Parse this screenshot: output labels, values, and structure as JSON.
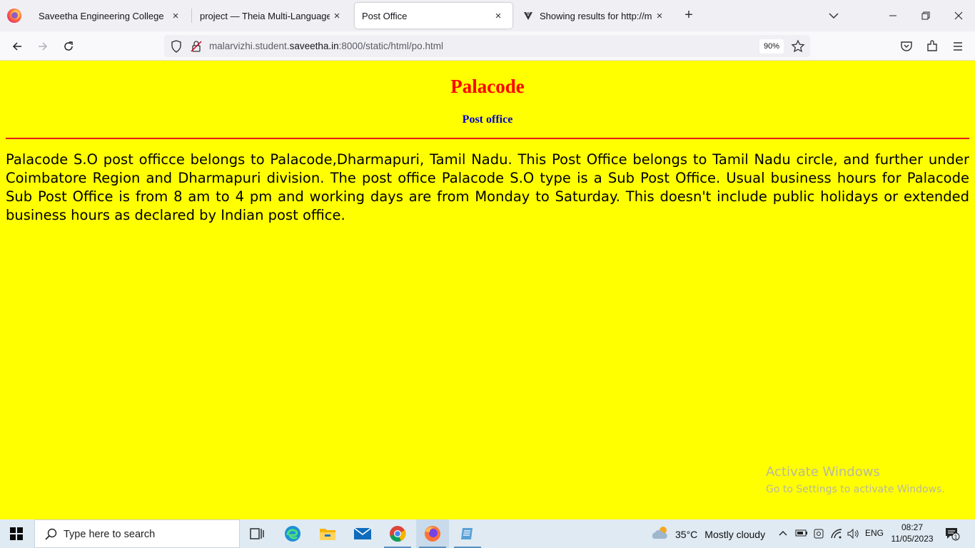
{
  "browser": {
    "tabs": [
      {
        "title": "Saveetha Engineering College",
        "close": "×",
        "active": false
      },
      {
        "title": "project — Theia Multi-Language Ex",
        "close": "×",
        "active": false
      },
      {
        "title": "Post Office",
        "close": "×",
        "active": true
      },
      {
        "title": "Showing results for http://malar",
        "close": "×",
        "active": false
      }
    ],
    "new_tab": "+",
    "url": {
      "prefix": "malarvizhi.student.",
      "host": "saveetha.in",
      "suffix": ":8000/static/html/po.html"
    },
    "zoom": "90%",
    "window_controls": {
      "minimize": "—",
      "restore": "❐",
      "close": "✕"
    }
  },
  "page": {
    "heading": "Palacode",
    "subheading": "Post office",
    "paragraph": "Palacode S.O post officce belongs to Palacode,Dharmapuri, Tamil Nadu. This Post Office belongs to Tamil Nadu circle, and further under Coimbatore Region and Dharmapuri division. The post office Palacode S.O type is a Sub Post Office. Usual business hours for Palacode Sub Post Office is from 8 am to 4 pm and working days are from Monday to Saturday. This doesn't include public holidays or extended business hours as declared by Indian post office.",
    "background_color": "#ffff00",
    "heading_color": "#ff0000",
    "subheading_color": "#0000cc"
  },
  "watermark": {
    "line1": "Activate Windows",
    "line2": "Go to Settings to activate Windows."
  },
  "taskbar": {
    "search_placeholder": "Type here to search",
    "apps": [
      "task-view-icon",
      "edge-icon",
      "file-explorer-icon",
      "mail-icon",
      "chrome-icon",
      "firefox-icon",
      "notepad-icon"
    ],
    "weather": {
      "temp": "35°C",
      "condition": "Mostly cloudy"
    },
    "language": "ENG",
    "time": "08:27",
    "date": "11/05/2023",
    "notifications": "1"
  }
}
